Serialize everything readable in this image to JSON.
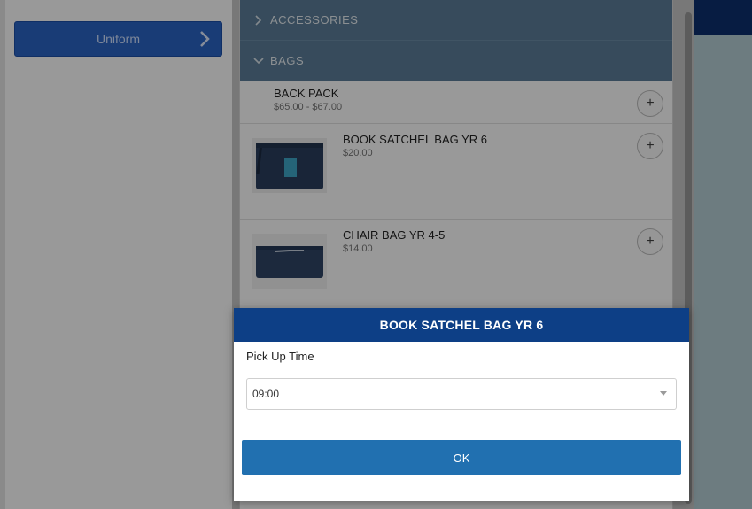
{
  "sidebar": {
    "uniform_label": "Uniform"
  },
  "categories": {
    "accessories": "ACCESSORIES",
    "bags": "BAGS"
  },
  "products": [
    {
      "name": "BACK PACK",
      "price": "$65.00 - $67.00",
      "add": "+"
    },
    {
      "name": "BOOK SATCHEL BAG YR 6",
      "price": "$20.00",
      "add": "+"
    },
    {
      "name": "CHAIR BAG YR 4-5",
      "price": "$14.00",
      "add": "+"
    }
  ],
  "dialog": {
    "title": "BOOK SATCHEL BAG YR 6",
    "field_label": "Pick Up Time",
    "selected_time": "09:00",
    "ok_label": "OK"
  },
  "colors": {
    "header_navy": "#0d3f86",
    "category_bar": "#5c7e99",
    "ok_button": "#2170b0",
    "uniform_button": "#2a64c5"
  }
}
